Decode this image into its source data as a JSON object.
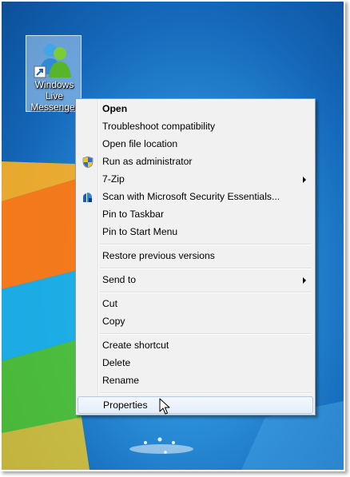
{
  "desktop": {
    "icon": {
      "label_lines": [
        "Windows",
        "Live",
        "Messenger"
      ],
      "icon_name": "windows-live-messenger-icon"
    }
  },
  "menu": {
    "items": [
      {
        "label": "Open",
        "bold": true
      },
      {
        "label": "Troubleshoot compatibility"
      },
      {
        "label": "Open file location"
      },
      {
        "label": "Run as administrator",
        "icon": "uac-shield-icon"
      },
      {
        "label": "7-Zip",
        "submenu": true
      },
      {
        "label": "Scan with Microsoft Security Essentials...",
        "icon": "security-essentials-icon"
      },
      {
        "label": "Pin to Taskbar"
      },
      {
        "label": "Pin to Start Menu"
      },
      {
        "label": "Restore previous versions"
      },
      {
        "label": "Send to",
        "submenu": true
      },
      {
        "label": "Cut"
      },
      {
        "label": "Copy"
      },
      {
        "label": "Create shortcut"
      },
      {
        "label": "Delete"
      },
      {
        "label": "Rename"
      },
      {
        "label": "Properties",
        "highlighted": true
      }
    ]
  },
  "colors": {
    "desktop_blue": "#1a73c4",
    "menu_background": "#f1f1f1",
    "highlight_border": "#b2c9e6"
  }
}
